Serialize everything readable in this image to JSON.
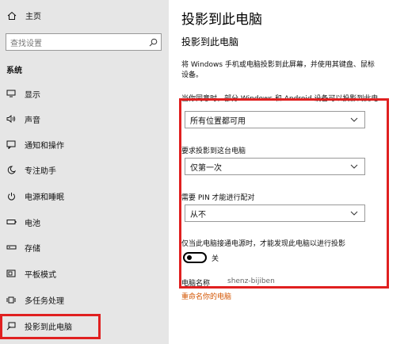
{
  "sidebar": {
    "home": {
      "label": "主页",
      "icon": "home-icon"
    },
    "search": {
      "placeholder": "查找设置",
      "icon": "search-icon"
    },
    "section_title": "系统",
    "items": [
      {
        "label": "显示",
        "icon": "display-icon"
      },
      {
        "label": "声音",
        "icon": "sound-icon"
      },
      {
        "label": "通知和操作",
        "icon": "notification-icon"
      },
      {
        "label": "专注助手",
        "icon": "moon-icon"
      },
      {
        "label": "电源和睡眠",
        "icon": "power-icon"
      },
      {
        "label": "电池",
        "icon": "battery-icon"
      },
      {
        "label": "存储",
        "icon": "storage-icon"
      },
      {
        "label": "平板模式",
        "icon": "tablet-mode-icon"
      },
      {
        "label": "多任务处理",
        "icon": "multitasking-icon"
      },
      {
        "label": "投影到此电脑",
        "icon": "project-icon"
      }
    ]
  },
  "main": {
    "page_title": "投影到此电脑",
    "sub_title": "投影到此电脑",
    "description_line1": "将 Windows 手机或电脑投影到此屏幕，并使用其键盘、鼠标",
    "description_line2": "设备。",
    "clipped_label": "当你同意时，部分 Windows 和 Android 设备可以投影到此电",
    "dropdown1_value": "所有位置都可用",
    "require_label": "要求投影到这台电脑",
    "dropdown2_value": "仅第一次",
    "pin_label": "需要 PIN 才能进行配对",
    "dropdown3_value": "从不",
    "power_label": "仅当此电脑接通电源时，才能发现此电脑以进行投影",
    "toggle_state": "关",
    "pc_name_label": "电脑名称",
    "pc_name_value": "shenz-bijiben",
    "rename_link": "重命名你的电脑"
  },
  "colors": {
    "highlight_box": "#e02020",
    "link": "#d35400",
    "sidebar_bg": "#e6e6e6"
  }
}
